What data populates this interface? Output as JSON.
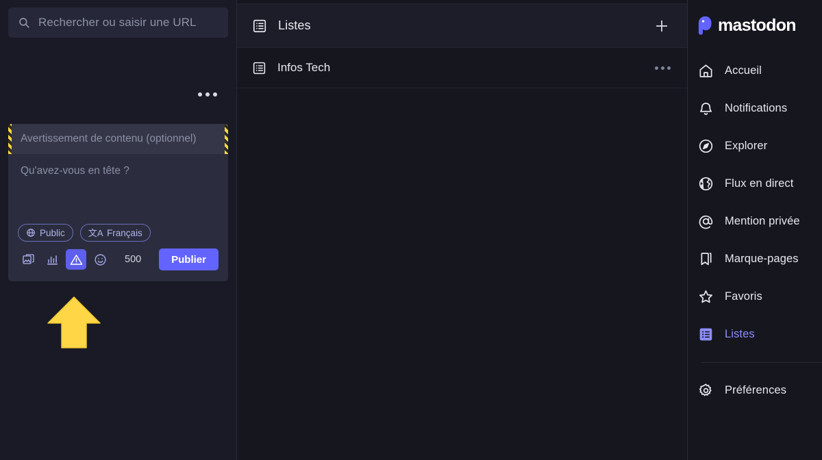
{
  "colors": {
    "page_bg": "#16161f",
    "panel_bg": "#191a26",
    "compose_bg": "#2b2d3f",
    "cw_bg": "#353749",
    "accent": "#6364ff",
    "accent_light": "#8c8dfa",
    "active_icon_bg": "#5e5fec",
    "annotation_arrow": "#ffd645",
    "hazard_stripe": "#ffd93b"
  },
  "search": {
    "placeholder": "Rechercher ou saisir une URL",
    "icon": "search-icon"
  },
  "compose": {
    "options_icon": "ellipsis-icon",
    "content_warning": {
      "placeholder": "Avertissement de contenu (optionnel)",
      "value": ""
    },
    "status": {
      "placeholder": "Qu'avez-vous en tête ?",
      "value": ""
    },
    "pills": [
      {
        "label": "Public",
        "icon": "globe-icon"
      },
      {
        "label": "Français",
        "icon": "translate-icon"
      }
    ],
    "actions": [
      {
        "name": "add-media-button",
        "icon": "image-icon",
        "active": false
      },
      {
        "name": "add-poll-button",
        "icon": "poll-icon",
        "active": false
      },
      {
        "name": "content-warning-button",
        "icon": "warning-triangle-icon",
        "active": true
      },
      {
        "name": "emoji-picker-button",
        "icon": "emoji-icon",
        "active": false
      }
    ],
    "char_count": "500",
    "publish_label": "Publier"
  },
  "annotation": {
    "type": "arrow-up",
    "target": "content-warning-button"
  },
  "lists_column": {
    "header": {
      "title": "Listes",
      "icon": "list-icon",
      "add_icon": "plus-icon"
    },
    "rows": [
      {
        "label": "Infos Tech",
        "icon": "list-icon",
        "more_icon": "ellipsis-icon"
      }
    ]
  },
  "sidebar": {
    "brand": {
      "wordmark": "mastodon",
      "logo_icon": "mastodon-logo-icon"
    },
    "items": [
      {
        "label": "Accueil",
        "icon": "home-icon",
        "active": false
      },
      {
        "label": "Notifications",
        "icon": "bell-icon",
        "active": false
      },
      {
        "label": "Explorer",
        "icon": "compass-icon",
        "active": false
      },
      {
        "label": "Flux en direct",
        "icon": "globe-icon",
        "active": false
      },
      {
        "label": "Mention privée",
        "icon": "at-icon",
        "active": false
      },
      {
        "label": "Marque-pages",
        "icon": "bookmark-icon",
        "active": false
      },
      {
        "label": "Favoris",
        "icon": "star-icon",
        "active": false
      },
      {
        "label": "Listes",
        "icon": "list-filled-icon",
        "active": true
      }
    ],
    "footer_items": [
      {
        "label": "Préférences",
        "icon": "gear-icon",
        "active": false
      }
    ]
  }
}
